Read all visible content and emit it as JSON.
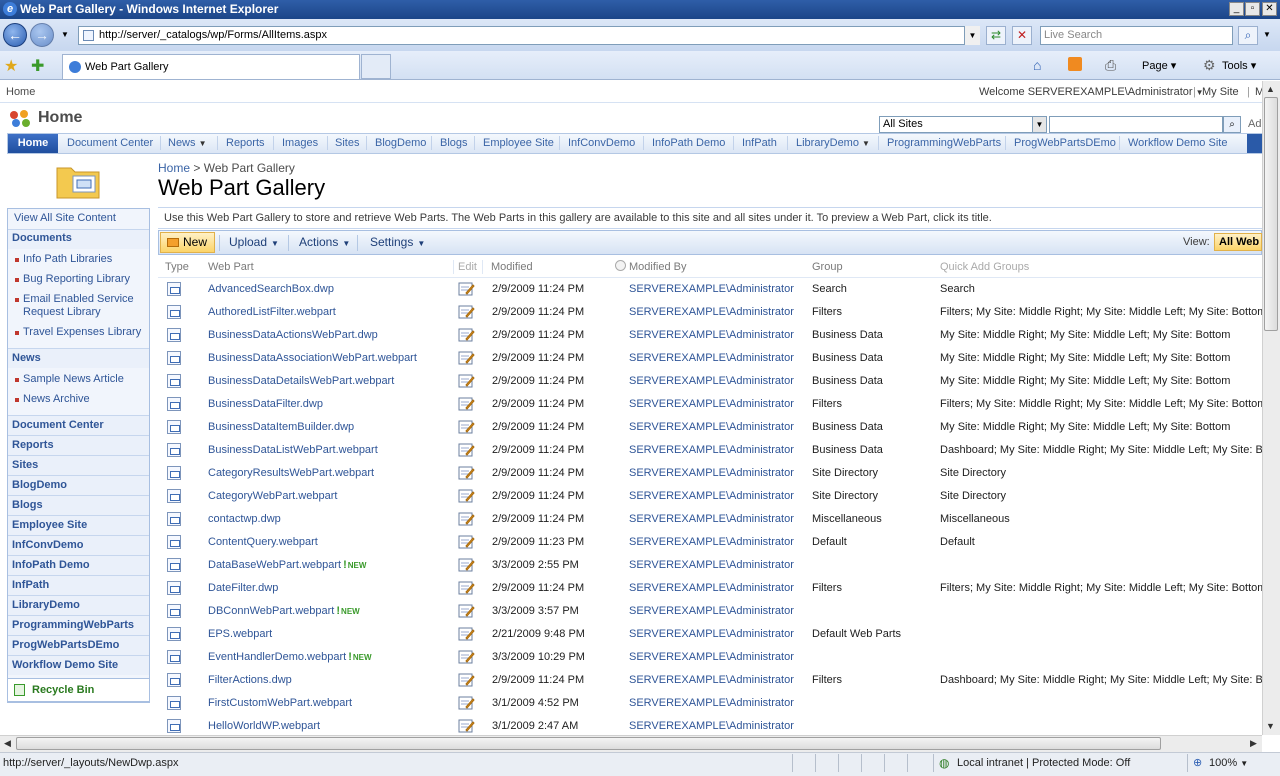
{
  "window": {
    "title": "Web Part Gallery - Windows Internet Explorer"
  },
  "browser": {
    "address": "http://server/_catalogs/wp/Forms/AllItems.aspx",
    "live_search_placeholder": "Live Search",
    "tab_title": "Web Part Gallery",
    "cmd_page": "Page",
    "cmd_tools": "Tools"
  },
  "sp": {
    "home_small": "Home",
    "welcome": "Welcome SERVEREXAMPLE\\Administrator",
    "mysite": "My Site",
    "mylinks_cut": "M",
    "site_title": "Home",
    "scope": "All Sites",
    "advanced_cut": "Ad",
    "topnav": [
      {
        "label": "Home",
        "dropdown": false
      },
      {
        "label": "Document Center",
        "dropdown": false
      },
      {
        "label": "News",
        "dropdown": true
      },
      {
        "label": "Reports",
        "dropdown": false
      },
      {
        "label": "Images",
        "dropdown": false
      },
      {
        "label": "Sites",
        "dropdown": false
      },
      {
        "label": "BlogDemo",
        "dropdown": false
      },
      {
        "label": "Blogs",
        "dropdown": false
      },
      {
        "label": "Employee Site",
        "dropdown": false
      },
      {
        "label": "InfConvDemo",
        "dropdown": false
      },
      {
        "label": "InfoPath Demo",
        "dropdown": false
      },
      {
        "label": "InfPath",
        "dropdown": false
      },
      {
        "label": "LibraryDemo",
        "dropdown": true
      },
      {
        "label": "ProgrammingWebParts",
        "dropdown": false
      },
      {
        "label": "ProgWebPartsDEmo",
        "dropdown": false
      },
      {
        "label": "Workflow Demo Site",
        "dropdown": false
      }
    ]
  },
  "quicklaunch": {
    "view_all": "View All Site Content",
    "documents_heading": "Documents",
    "documents": [
      "Info Path Libraries",
      "Bug Reporting Library",
      "Email Enabled Service Request Library",
      "Travel Expenses Library"
    ],
    "news_heading": "News",
    "news": [
      "Sample News Article",
      "News Archive"
    ],
    "headings": [
      "Document Center",
      "Reports",
      "Sites",
      "BlogDemo",
      "Blogs",
      "Employee Site",
      "InfConvDemo",
      "InfoPath Demo",
      "InfPath",
      "LibraryDemo",
      "ProgrammingWebParts",
      "ProgWebPartsDEmo",
      "Workflow Demo Site"
    ],
    "recycle_bin": "Recycle Bin"
  },
  "main": {
    "breadcrumb_home": "Home",
    "breadcrumb_sep": ">",
    "breadcrumb_current": "Web Part Gallery",
    "title": "Web Part Gallery",
    "description": "Use this Web Part Gallery to store and retrieve Web Parts. The Web Parts in this gallery are available to this site and all sites under it. To preview a Web Part, click its title.",
    "toolbar": {
      "new": "New",
      "upload": "Upload",
      "actions": "Actions",
      "settings": "Settings",
      "view_label": "View:",
      "view_value": "All Web Parts"
    },
    "columns": {
      "type": "Type",
      "name": "Web Part",
      "edit": "Edit",
      "modified": "Modified",
      "modified_by": "Modified By",
      "group": "Group",
      "quick_add": "Quick Add Groups"
    },
    "new_badge": "NEW",
    "rows": [
      {
        "name": "AdvancedSearchBox.dwp",
        "modified": "2/9/2009 11:24 PM",
        "by": "SERVEREXAMPLE\\Administrator",
        "group": "Search",
        "quick": "Search",
        "isnew": false
      },
      {
        "name": "AuthoredListFilter.webpart",
        "modified": "2/9/2009 11:24 PM",
        "by": "SERVEREXAMPLE\\Administrator",
        "group": "Filters",
        "quick": "Filters; My Site: Middle Right; My Site: Middle Left; My Site: Bottom",
        "isnew": false
      },
      {
        "name": "BusinessDataActionsWebPart.dwp",
        "modified": "2/9/2009 11:24 PM",
        "by": "SERVEREXAMPLE\\Administrator",
        "group": "Business Data",
        "quick": "My Site: Middle Right; My Site: Middle Left; My Site: Bottom",
        "isnew": false
      },
      {
        "name": "BusinessDataAssociationWebPart.webpart",
        "modified": "2/9/2009 11:24 PM",
        "by": "SERVEREXAMPLE\\Administrator",
        "group": "Business Data",
        "quick": "My Site: Middle Right; My Site: Middle Left; My Site: Bottom",
        "isnew": false
      },
      {
        "name": "BusinessDataDetailsWebPart.webpart",
        "modified": "2/9/2009 11:24 PM",
        "by": "SERVEREXAMPLE\\Administrator",
        "group": "Business Data",
        "quick": "My Site: Middle Right; My Site: Middle Left; My Site: Bottom",
        "isnew": false
      },
      {
        "name": "BusinessDataFilter.dwp",
        "modified": "2/9/2009 11:24 PM",
        "by": "SERVEREXAMPLE\\Administrator",
        "group": "Filters",
        "quick": "Filters; My Site: Middle Right; My Site: Middle Left; My Site: Bottom",
        "isnew": false
      },
      {
        "name": "BusinessDataItemBuilder.dwp",
        "modified": "2/9/2009 11:24 PM",
        "by": "SERVEREXAMPLE\\Administrator",
        "group": "Business Data",
        "quick": "My Site: Middle Right; My Site: Middle Left; My Site: Bottom",
        "isnew": false
      },
      {
        "name": "BusinessDataListWebPart.webpart",
        "modified": "2/9/2009 11:24 PM",
        "by": "SERVEREXAMPLE\\Administrator",
        "group": "Business Data",
        "quick": "Dashboard; My Site: Middle Right; My Site: Middle Left; My Site: Bottom",
        "isnew": false
      },
      {
        "name": "CategoryResultsWebPart.webpart",
        "modified": "2/9/2009 11:24 PM",
        "by": "SERVEREXAMPLE\\Administrator",
        "group": "Site Directory",
        "quick": "Site Directory",
        "isnew": false
      },
      {
        "name": "CategoryWebPart.webpart",
        "modified": "2/9/2009 11:24 PM",
        "by": "SERVEREXAMPLE\\Administrator",
        "group": "Site Directory",
        "quick": "Site Directory",
        "isnew": false
      },
      {
        "name": "contactwp.dwp",
        "modified": "2/9/2009 11:24 PM",
        "by": "SERVEREXAMPLE\\Administrator",
        "group": "Miscellaneous",
        "quick": "Miscellaneous",
        "isnew": false
      },
      {
        "name": "ContentQuery.webpart",
        "modified": "2/9/2009 11:23 PM",
        "by": "SERVEREXAMPLE\\Administrator",
        "group": "Default",
        "quick": "Default",
        "isnew": false
      },
      {
        "name": "DataBaseWebPart.webpart",
        "modified": "3/3/2009 2:55 PM",
        "by": "SERVEREXAMPLE\\Administrator",
        "group": "",
        "quick": "",
        "isnew": true
      },
      {
        "name": "DateFilter.dwp",
        "modified": "2/9/2009 11:24 PM",
        "by": "SERVEREXAMPLE\\Administrator",
        "group": "Filters",
        "quick": "Filters; My Site: Middle Right; My Site: Middle Left; My Site: Bottom",
        "isnew": false
      },
      {
        "name": "DBConnWebPart.webpart",
        "modified": "3/3/2009 3:57 PM",
        "by": "SERVEREXAMPLE\\Administrator",
        "group": "",
        "quick": "",
        "isnew": true
      },
      {
        "name": "EPS.webpart",
        "modified": "2/21/2009 9:48 PM",
        "by": "SERVEREXAMPLE\\Administrator",
        "group": "Default Web Parts",
        "quick": "",
        "isnew": false
      },
      {
        "name": "EventHandlerDemo.webpart",
        "modified": "3/3/2009 10:29 PM",
        "by": "SERVEREXAMPLE\\Administrator",
        "group": "",
        "quick": "",
        "isnew": true
      },
      {
        "name": "FilterActions.dwp",
        "modified": "2/9/2009 11:24 PM",
        "by": "SERVEREXAMPLE\\Administrator",
        "group": "Filters",
        "quick": "Dashboard; My Site: Middle Right; My Site: Middle Left; My Site: Bottom",
        "isnew": false
      },
      {
        "name": "FirstCustomWebPart.webpart",
        "modified": "3/1/2009 4:52 PM",
        "by": "SERVEREXAMPLE\\Administrator",
        "group": "",
        "quick": "",
        "isnew": false
      },
      {
        "name": "HelloWorldWP.webpart",
        "modified": "3/1/2009 2:47 AM",
        "by": "SERVEREXAMPLE\\Administrator",
        "group": "",
        "quick": "",
        "isnew": false
      }
    ]
  },
  "status": {
    "url": "http://server/_layouts/NewDwp.aspx",
    "zone": "Local intranet | Protected Mode: Off",
    "zoom": "100%"
  }
}
